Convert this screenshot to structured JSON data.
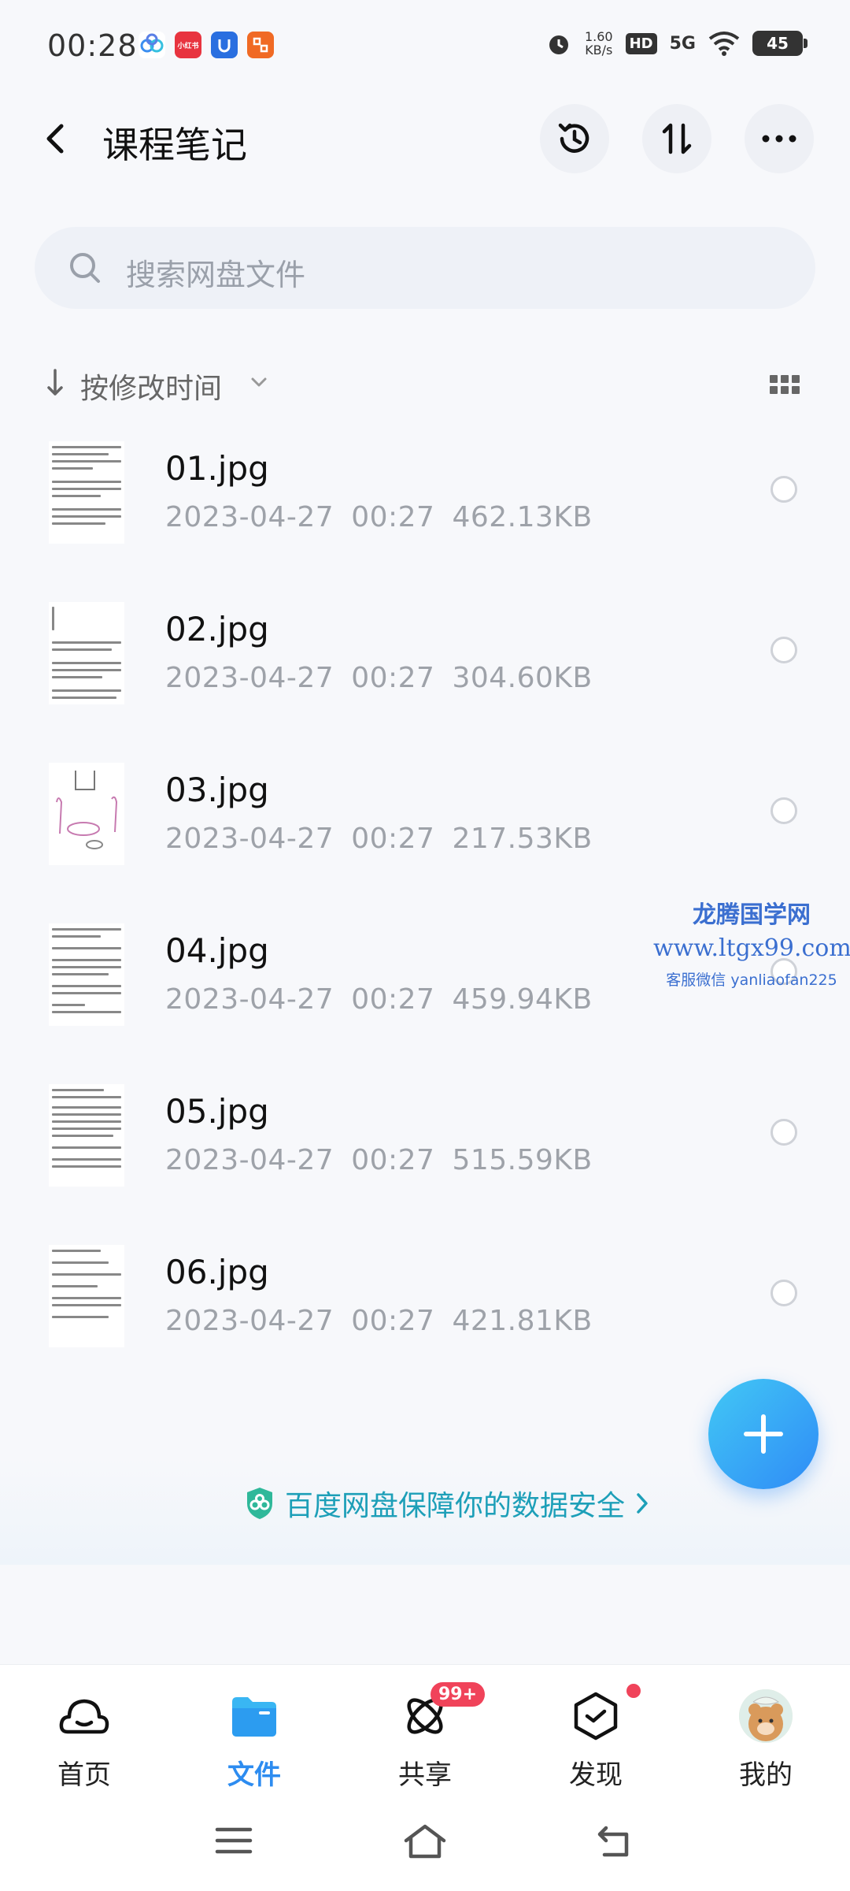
{
  "status_bar": {
    "time": "00:28",
    "speed_value": "1.60",
    "speed_unit": "KB/s",
    "hd_label": "HD",
    "signal_label": "5G",
    "battery": "45",
    "app_icons": [
      "cloud-app-icon",
      "xiaohongshu-icon",
      "security-app-icon",
      "taobao-app-icon"
    ],
    "xiaohongshu_label": "小红书"
  },
  "header": {
    "title": "课程笔记"
  },
  "search": {
    "placeholder": "搜索网盘文件"
  },
  "sort": {
    "label": "按修改时间"
  },
  "files": [
    {
      "name": "01.jpg",
      "date": "2023-04-27",
      "time": "00:27",
      "size": "462.13KB"
    },
    {
      "name": "02.jpg",
      "date": "2023-04-27",
      "time": "00:27",
      "size": "304.60KB"
    },
    {
      "name": "03.jpg",
      "date": "2023-04-27",
      "time": "00:27",
      "size": "217.53KB"
    },
    {
      "name": "04.jpg",
      "date": "2023-04-27",
      "time": "00:27",
      "size": "459.94KB"
    },
    {
      "name": "05.jpg",
      "date": "2023-04-27",
      "time": "00:27",
      "size": "515.59KB"
    },
    {
      "name": "06.jpg",
      "date": "2023-04-27",
      "time": "00:27",
      "size": "421.81KB"
    }
  ],
  "watermark": {
    "line1": "龙腾国学网",
    "line2": "www.ltgx99.com",
    "line3": "客服微信 yanliaofan225"
  },
  "banner": {
    "text": "百度网盘保障你的数据安全"
  },
  "nav": {
    "items": [
      {
        "label": "首页"
      },
      {
        "label": "文件"
      },
      {
        "label": "共享",
        "badge": "99+"
      },
      {
        "label": "发现"
      },
      {
        "label": "我的"
      }
    ]
  },
  "colors": {
    "accent": "#2d8cf0",
    "badge": "#f0435a",
    "banner_text": "#1d9fb8"
  }
}
